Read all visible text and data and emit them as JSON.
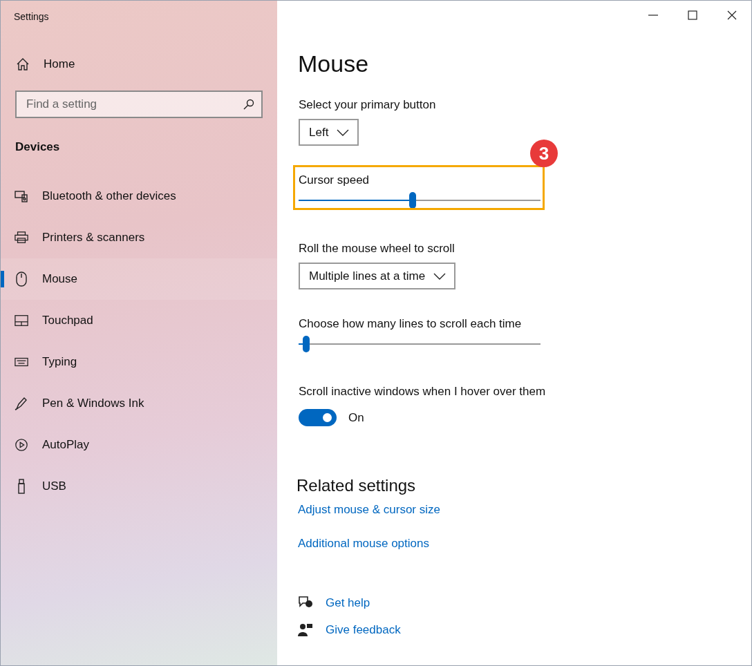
{
  "window": {
    "title": "Settings"
  },
  "sidebar": {
    "home": "Home",
    "search": {
      "placeholder": "Find a setting"
    },
    "section": "Devices",
    "items": [
      {
        "label": "Bluetooth & other devices",
        "selected": false
      },
      {
        "label": "Printers & scanners",
        "selected": false
      },
      {
        "label": "Mouse",
        "selected": true
      },
      {
        "label": "Touchpad",
        "selected": false
      },
      {
        "label": "Typing",
        "selected": false
      },
      {
        "label": "Pen & Windows Ink",
        "selected": false
      },
      {
        "label": "AutoPlay",
        "selected": false
      },
      {
        "label": "USB",
        "selected": false
      }
    ]
  },
  "main": {
    "title": "Mouse",
    "settings": [
      {
        "kind": "dropdown",
        "label": "Select your primary button",
        "value": "Left",
        "highlighted": false
      },
      {
        "kind": "slider",
        "label": "Cursor speed",
        "level": 0.47,
        "highlighted": true
      },
      {
        "kind": "dropdown",
        "label": "Roll the mouse wheel to scroll",
        "value": "Multiple lines at a time",
        "highlighted": false
      },
      {
        "kind": "slider",
        "label": "Choose how many lines to scroll each time",
        "level": 0.03,
        "highlighted": false
      },
      {
        "kind": "toggle",
        "label": "Scroll inactive windows when I hover over them",
        "on": true,
        "state_text": "On",
        "highlighted": false
      }
    ],
    "related": {
      "title": "Related settings",
      "links": [
        "Adjust mouse & cursor size",
        "Additional mouse options"
      ]
    },
    "help": [
      {
        "kind": "help",
        "label": "Get help"
      },
      {
        "kind": "feedback",
        "label": "Give feedback"
      }
    ]
  },
  "annotation": {
    "badge": "3"
  }
}
